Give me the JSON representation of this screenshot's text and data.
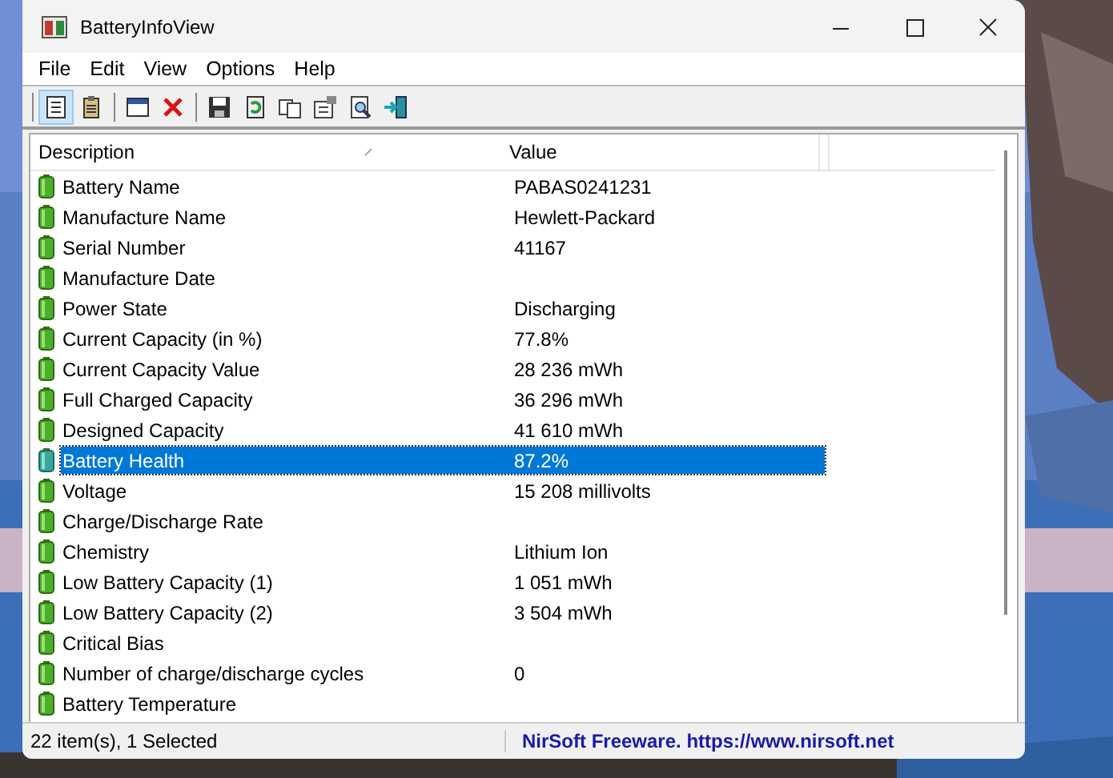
{
  "window": {
    "title": "BatteryInfoView"
  },
  "menu": [
    "File",
    "Edit",
    "View",
    "Options",
    "Help"
  ],
  "toolbar": [
    [
      {
        "pressed": true
      },
      {
        "pressed": false
      }
    ],
    [
      {
        "pressed": false
      },
      {
        "pressed": false
      }
    ],
    [
      {
        "pressed": false
      },
      {
        "pressed": false
      },
      {
        "pressed": false
      },
      {
        "pressed": false
      },
      {
        "pressed": false
      },
      {
        "pressed": false
      }
    ]
  ],
  "table": {
    "columns": [
      "Description",
      "Value"
    ],
    "rows": [
      {
        "description": "Battery Name",
        "value": "PABAS0241231",
        "selected": false
      },
      {
        "description": "Manufacture Name",
        "value": "Hewlett-Packard",
        "selected": false
      },
      {
        "description": "Serial Number",
        "value": "41167",
        "selected": false
      },
      {
        "description": "Manufacture Date",
        "selected": false
      },
      {
        "description": "Power State",
        "value": "Discharging",
        "selected": false
      },
      {
        "description": "Current Capacity (in %)",
        "value": "77.8%",
        "selected": false
      },
      {
        "description": "Current Capacity Value",
        "value": "28 236 mWh",
        "selected": false
      },
      {
        "description": "Full Charged Capacity",
        "value": "36 296 mWh",
        "selected": false
      },
      {
        "description": "Designed Capacity",
        "value": "41 610 mWh",
        "selected": false
      },
      {
        "description": "Battery Health",
        "value": "87.2%",
        "selected": true
      },
      {
        "description": "Voltage",
        "value": "15 208 millivolts",
        "selected": false
      },
      {
        "description": "Charge/Discharge Rate",
        "selected": false
      },
      {
        "description": "Chemistry",
        "value": "Lithium Ion",
        "selected": false
      },
      {
        "description": "Low Battery Capacity (1)",
        "value": "1 051 mWh",
        "selected": false
      },
      {
        "description": "Low Battery Capacity (2)",
        "value": "3 504 mWh",
        "selected": false
      },
      {
        "description": "Critical Bias",
        "selected": false
      },
      {
        "description": "Number of charge/discharge cycles",
        "value": "0",
        "selected": false
      },
      {
        "description": "Battery Temperature",
        "selected": false
      }
    ]
  },
  "status_bar": {
    "count": "22 item(s), 1 Selected",
    "link": "NirSoft Freeware. https://www.nirsoft.net"
  }
}
